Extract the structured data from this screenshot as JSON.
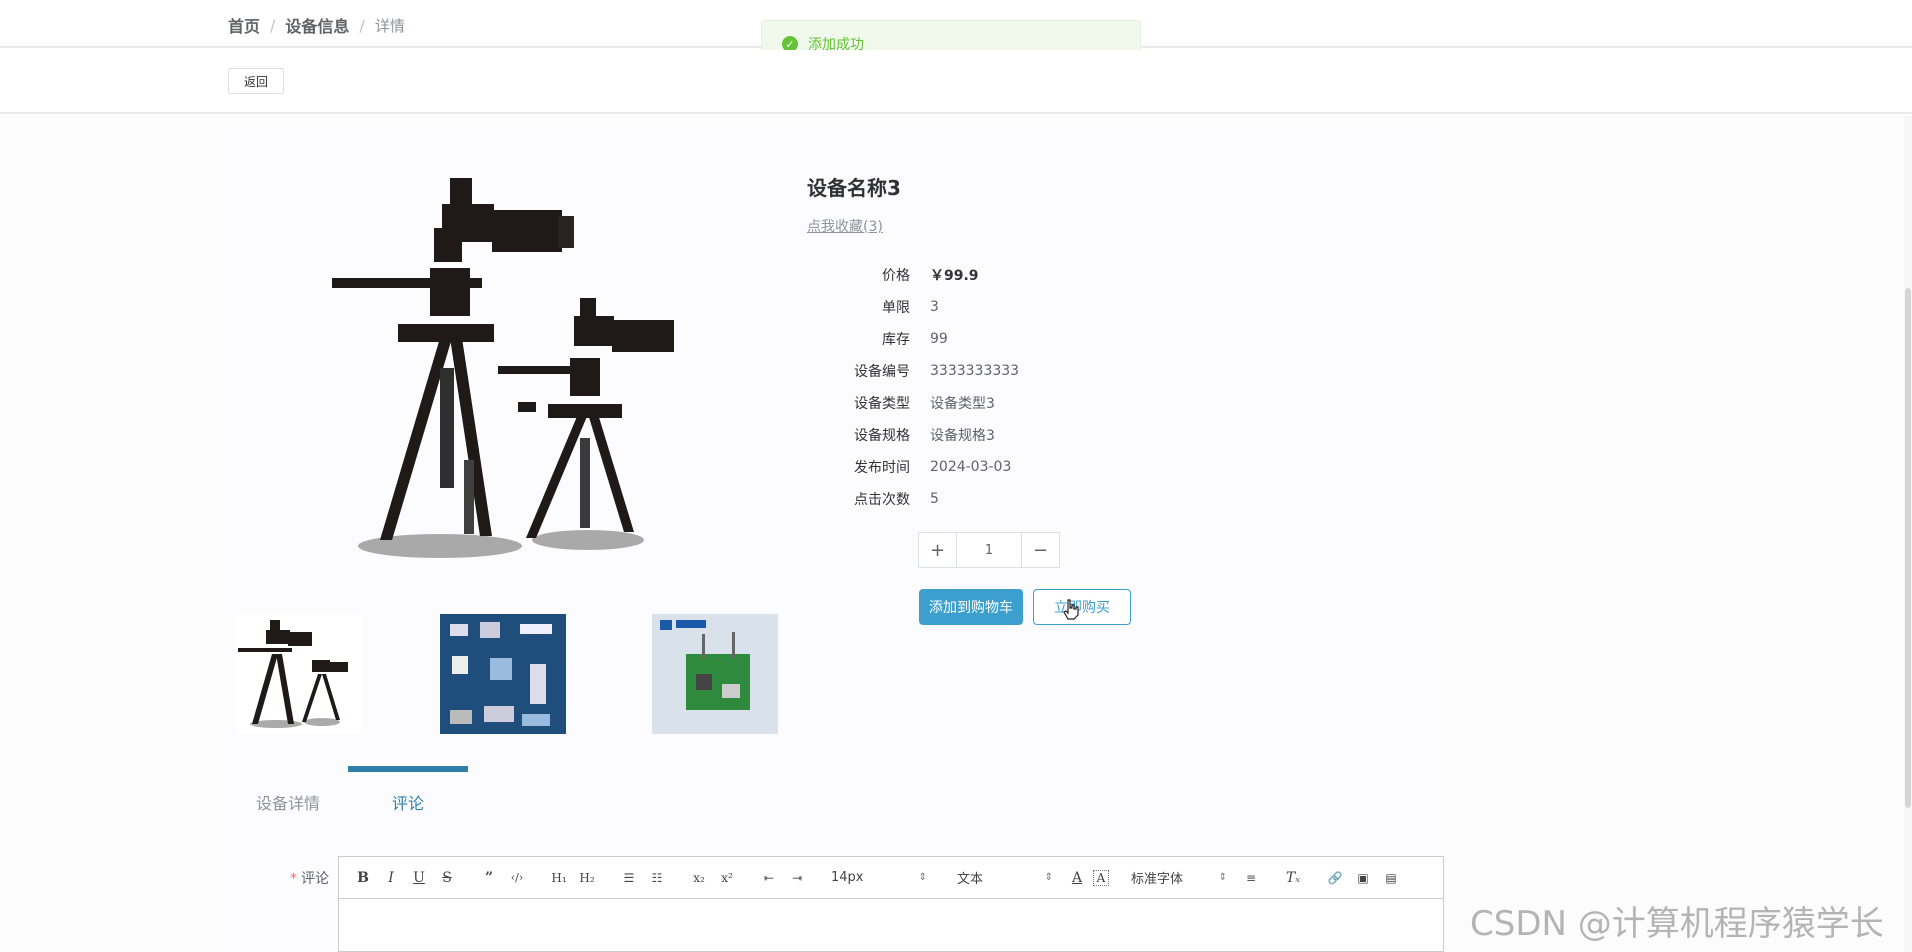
{
  "breadcrumb": {
    "home": "首页",
    "section": "设备信息",
    "current": "详情"
  },
  "toast": {
    "text": "添加成功",
    "icon": "check-circle-icon",
    "color": "#67c23a"
  },
  "back_button": "返回",
  "product": {
    "title": "设备名称3",
    "favorite_link": "点我收藏(3)",
    "info": [
      {
        "label": "价格",
        "value": "￥99.9"
      },
      {
        "label": "单限",
        "value": "3"
      },
      {
        "label": "库存",
        "value": "99"
      },
      {
        "label": "设备编号",
        "value": "3333333333"
      },
      {
        "label": "设备类型",
        "value": "设备类型3"
      },
      {
        "label": "设备规格",
        "value": "设备规格3"
      },
      {
        "label": "发布时间",
        "value": "2024-03-03"
      },
      {
        "label": "点击次数",
        "value": "5"
      }
    ],
    "quantity": "1",
    "plus": "+",
    "minus": "−",
    "add_to_cart": "添加到购物车",
    "buy_now": "立即购买"
  },
  "tabs": {
    "details": "设备详情",
    "comments": "评论"
  },
  "comment": {
    "required_mark": "*",
    "label": "评论",
    "font_size": "14px",
    "block_type": "文本",
    "font_family": "标准字体"
  },
  "watermark": "CSDN @计算机程序猿学长",
  "colors": {
    "primary": "#3d9fcd",
    "tab_active": "#2f7fa8",
    "success": "#67c23a"
  }
}
